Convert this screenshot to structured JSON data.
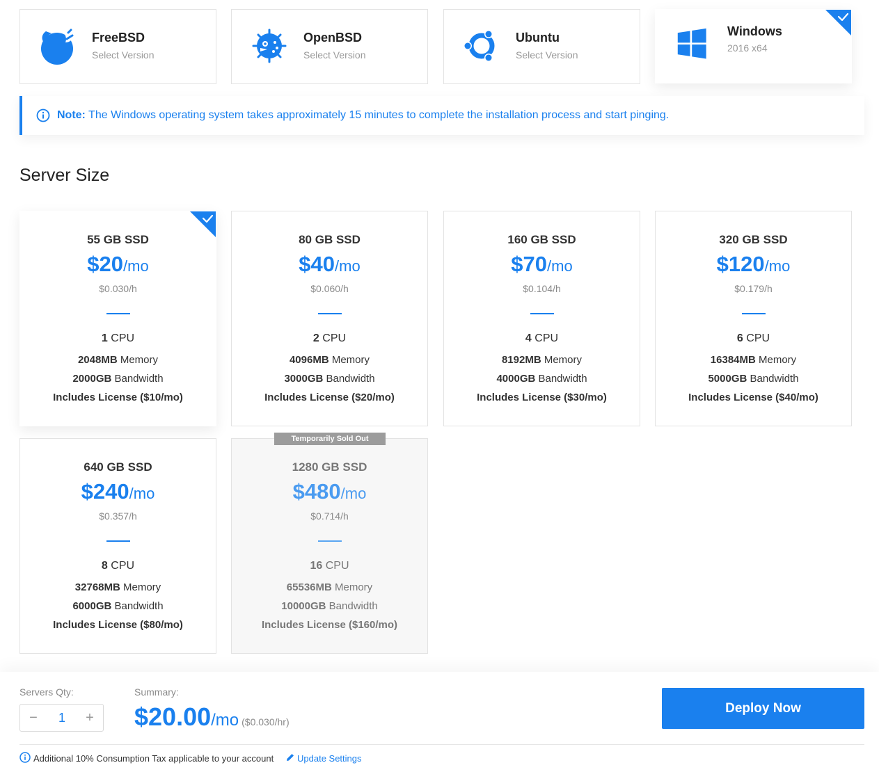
{
  "os_options": [
    {
      "name": "FreeBSD",
      "sub": "Select Version",
      "icon": "freebsd-icon",
      "selected": false
    },
    {
      "name": "OpenBSD",
      "sub": "Select Version",
      "icon": "openbsd-icon",
      "selected": false
    },
    {
      "name": "Ubuntu",
      "sub": "Select Version",
      "icon": "ubuntu-icon",
      "selected": false
    },
    {
      "name": "Windows",
      "sub": "2016  x64",
      "icon": "windows-icon",
      "selected": true
    }
  ],
  "note": {
    "label": "Note:",
    "text": " The Windows operating system takes approximately 15 minutes to complete the installation process and start pinging."
  },
  "server_size": {
    "title": "Server Size",
    "plans": [
      {
        "storage": "55 GB SSD",
        "price": "$20",
        "per": "/mo",
        "hourly": "$0.030/h",
        "cpu_num": "1",
        "cpu_label": " CPU",
        "mem_num": "2048MB",
        "mem_label": " Memory",
        "bw_num": "2000GB",
        "bw_label": " Bandwidth",
        "license": "Includes License ($10/mo)",
        "selected": true,
        "sold_out": false
      },
      {
        "storage": "80 GB SSD",
        "price": "$40",
        "per": "/mo",
        "hourly": "$0.060/h",
        "cpu_num": "2",
        "cpu_label": " CPU",
        "mem_num": "4096MB",
        "mem_label": " Memory",
        "bw_num": "3000GB",
        "bw_label": " Bandwidth",
        "license": "Includes License ($20/mo)",
        "selected": false,
        "sold_out": false
      },
      {
        "storage": "160 GB SSD",
        "price": "$70",
        "per": "/mo",
        "hourly": "$0.104/h",
        "cpu_num": "4",
        "cpu_label": " CPU",
        "mem_num": "8192MB",
        "mem_label": " Memory",
        "bw_num": "4000GB",
        "bw_label": " Bandwidth",
        "license": "Includes License ($30/mo)",
        "selected": false,
        "sold_out": false
      },
      {
        "storage": "320 GB SSD",
        "price": "$120",
        "per": "/mo",
        "hourly": "$0.179/h",
        "cpu_num": "6",
        "cpu_label": " CPU",
        "mem_num": "16384MB",
        "mem_label": " Memory",
        "bw_num": "5000GB",
        "bw_label": " Bandwidth",
        "license": "Includes License ($40/mo)",
        "selected": false,
        "sold_out": false
      },
      {
        "storage": "640 GB SSD",
        "price": "$240",
        "per": "/mo",
        "hourly": "$0.357/h",
        "cpu_num": "8",
        "cpu_label": " CPU",
        "mem_num": "32768MB",
        "mem_label": " Memory",
        "bw_num": "6000GB",
        "bw_label": " Bandwidth",
        "license": "Includes License ($80/mo)",
        "selected": false,
        "sold_out": false
      },
      {
        "storage": "1280 GB SSD",
        "price": "$480",
        "per": "/mo",
        "hourly": "$0.714/h",
        "cpu_num": "16",
        "cpu_label": " CPU",
        "mem_num": "65536MB",
        "mem_label": " Memory",
        "bw_num": "10000GB",
        "bw_label": " Bandwidth",
        "license": "Includes License ($160/mo)",
        "selected": false,
        "sold_out": true,
        "badge": "Temporarily Sold Out"
      }
    ]
  },
  "footer": {
    "qty_label": "Servers Qty:",
    "qty_value": "1",
    "minus": "−",
    "plus": "+",
    "summary_label": "Summary:",
    "summary_price": "$20.00",
    "summary_per": "/mo",
    "summary_hourly": "($0.030/hr)",
    "deploy_label": "Deploy Now",
    "tax_text": "Additional 10% Consumption Tax applicable to your account",
    "update_link": "Update Settings"
  },
  "colors": {
    "accent": "#1a80ee",
    "muted": "#8a8a8a",
    "border": "#e3e3e3",
    "soldout_badge": "#9c9c9c"
  }
}
